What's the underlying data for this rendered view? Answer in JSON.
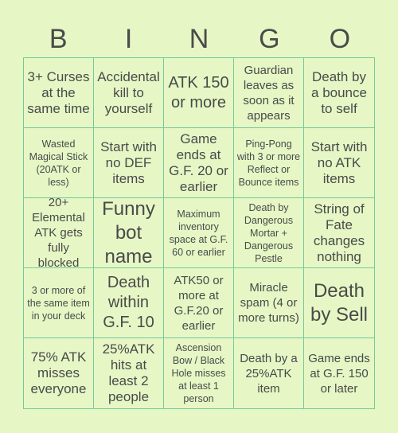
{
  "header": {
    "letters": [
      "B",
      "I",
      "N",
      "G",
      "O"
    ]
  },
  "colors": {
    "background": "#e6f7c5",
    "border": "#74c99a",
    "text": "#4a4a4a"
  },
  "cells": [
    {
      "text": "3+ Curses at the same time"
    },
    {
      "text": "Accidental kill to yourself"
    },
    {
      "text": "ATK 150 or more"
    },
    {
      "text": "Guardian leaves as soon as it appears"
    },
    {
      "text": "Death by a bounce to self"
    },
    {
      "text": "Wasted Magical Stick (20ATK or less)"
    },
    {
      "text": "Start with no DEF items"
    },
    {
      "text": "Game ends at G.F. 20 or earlier"
    },
    {
      "text": "Ping-Pong with 3 or more Reflect or Bounce items"
    },
    {
      "text": "Start with no ATK items"
    },
    {
      "text": "20+ Elemental ATK gets fully blocked"
    },
    {
      "text": "Funny bot name"
    },
    {
      "text": "Maximum inventory space at G.F. 60 or earlier"
    },
    {
      "text": "Death by Dangerous Mortar + Dangerous Pestle"
    },
    {
      "text": "String of Fate changes nothing"
    },
    {
      "text": "3 or more of the same item in your deck"
    },
    {
      "text": "Death within G.F. 10"
    },
    {
      "text": "ATK50 or more at G.F.20 or earlier"
    },
    {
      "text": "Miracle spam (4 or more turns)"
    },
    {
      "text": "Death by Sell"
    },
    {
      "text": "75% ATK misses everyone"
    },
    {
      "text": "25%ATK hits at least 2 people"
    },
    {
      "text": "Ascension Bow / Black Hole misses at least 1 person"
    },
    {
      "text": "Death by a 25%ATK item"
    },
    {
      "text": "Game ends at G.F. 150 or later"
    }
  ]
}
